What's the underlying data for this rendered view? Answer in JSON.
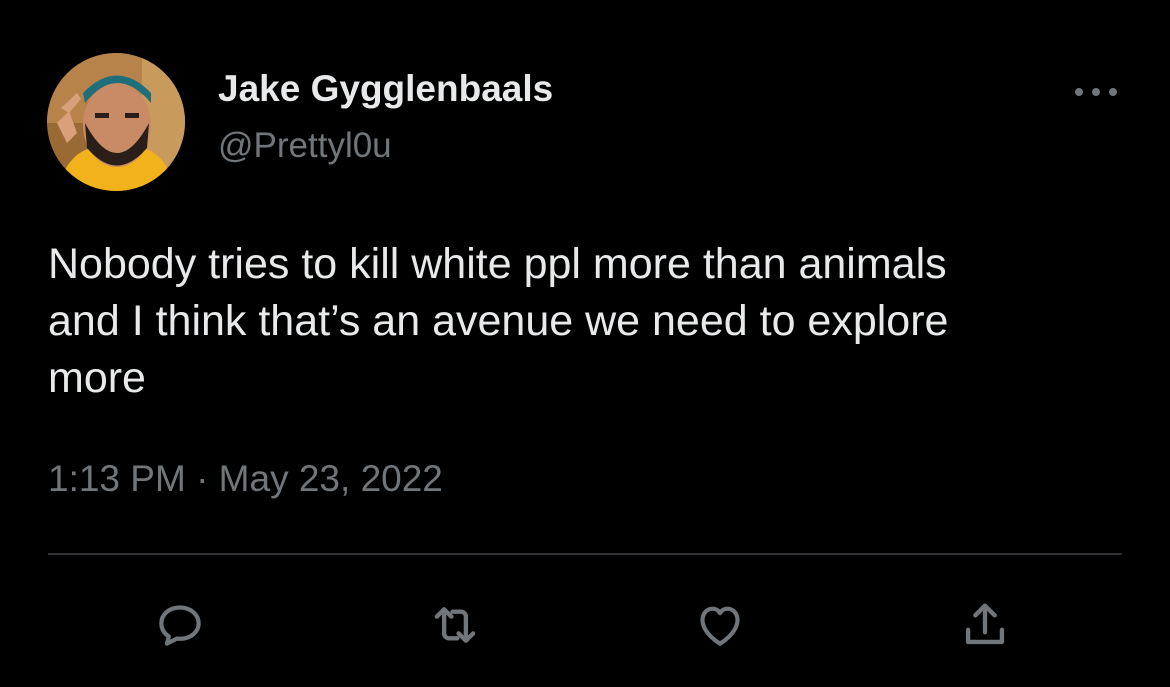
{
  "author": {
    "name": "Jake Gygglenbaals",
    "handle": "@Prettyl0u"
  },
  "tweet": {
    "text": "Nobody tries to kill white ppl more than animals\nand I think that’s an avenue we need to explore\nmore",
    "timestamp": "1:13 PM · May 23, 2022"
  },
  "icons": {
    "more": "more-horizontal-icon",
    "reply": "reply-icon",
    "retweet": "retweet-icon",
    "like": "heart-icon",
    "share": "share-icon"
  },
  "colors": {
    "background": "#000000",
    "primary_text": "#e7e9ea",
    "secondary_text": "#71767b",
    "divider": "#2f3336"
  }
}
